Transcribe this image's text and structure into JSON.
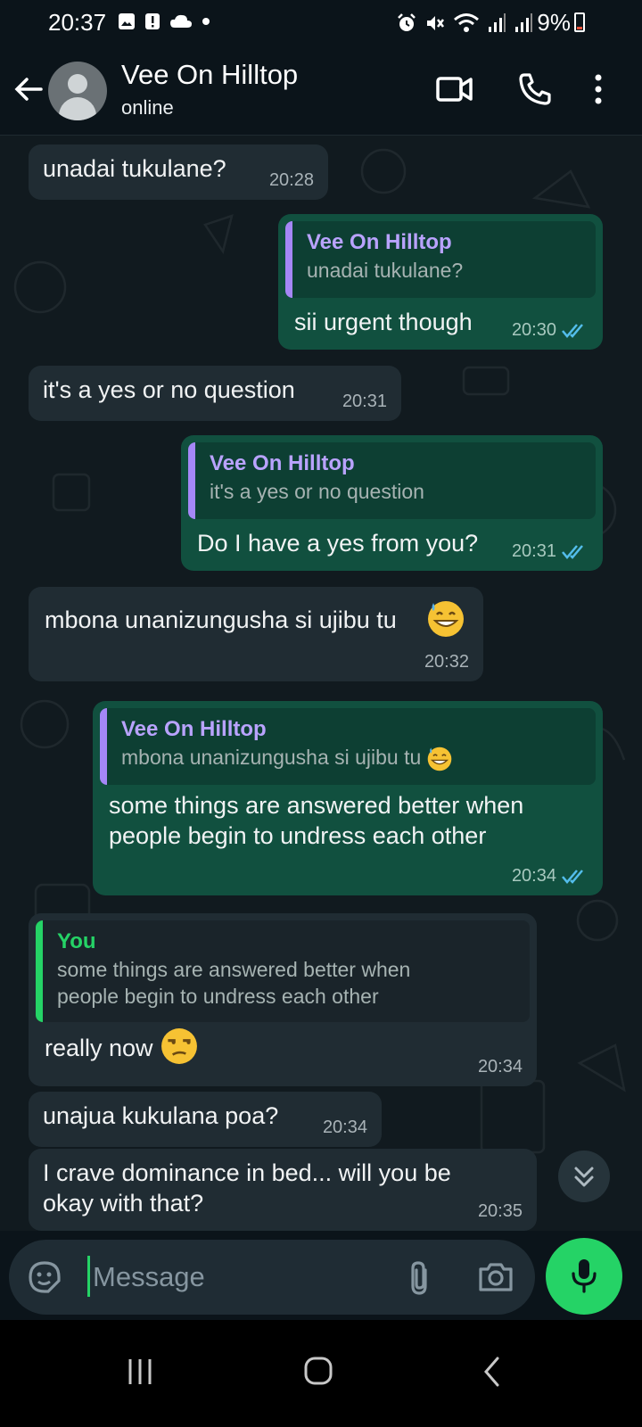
{
  "status_bar": {
    "time": "20:37",
    "battery": "9%",
    "icons": [
      "gallery-icon",
      "alert-icon",
      "cloud-icon",
      "dot-icon",
      "alarm-icon",
      "mute-icon",
      "wifi-icon",
      "signal-icon",
      "signal-icon-2",
      "battery-icon"
    ]
  },
  "header": {
    "contact_name": "Vee On Hilltop",
    "status": "online",
    "icons": [
      "back-arrow-icon",
      "avatar",
      "video-call-icon",
      "phone-call-icon",
      "more-vert-icon"
    ]
  },
  "messages": [
    {
      "direction": "in",
      "text": "unadai tukulane?",
      "time": "20:28"
    },
    {
      "direction": "out",
      "quote_author": "Vee On Hilltop",
      "quote_text": "unadai tukulane?",
      "text": "sii urgent though",
      "time": "20:30",
      "read": true
    },
    {
      "direction": "in",
      "text": "it's a yes or no question",
      "time": "20:31"
    },
    {
      "direction": "out",
      "quote_author": "Vee On Hilltop",
      "quote_text": "it's a yes or no question",
      "text": "Do I have a yes from you?",
      "time": "20:31",
      "read": true
    },
    {
      "direction": "in",
      "text": "mbona unanizungusha si ujibu tu",
      "emoji": "grinning-sweat-emoji",
      "time": "20:32"
    },
    {
      "direction": "out",
      "quote_author": "Vee On Hilltop",
      "quote_text": "mbona unanizungusha si ujibu tu",
      "text_line1": "some things are answered better when",
      "text_line2": "people begin to   undress each other",
      "time": "20:34",
      "read": true
    },
    {
      "direction": "in",
      "quote_author": "You",
      "quote_line1": "some things are answered better when",
      "quote_line2": "people begin to   undress each other",
      "text": "really now",
      "emoji": "unamused-emoji",
      "time": "20:34"
    },
    {
      "direction": "in",
      "text": "unajua kukulana poa?",
      "time": "20:34"
    },
    {
      "direction": "in",
      "text_line1": "I crave dominance in bed... will you be",
      "text_line2": "okay with that?",
      "time": "20:35"
    }
  ],
  "input": {
    "placeholder": "Message",
    "icons": [
      "sticker-icon",
      "attach-icon",
      "camera-icon",
      "mic-icon"
    ]
  },
  "colors": {
    "background": "#0b141a",
    "incoming_bubble": "#202c33",
    "outgoing_bubble": "#11503f",
    "accent_green": "#25d366",
    "quote_purple": "#a587f7",
    "read_tick": "#53bdeb"
  }
}
